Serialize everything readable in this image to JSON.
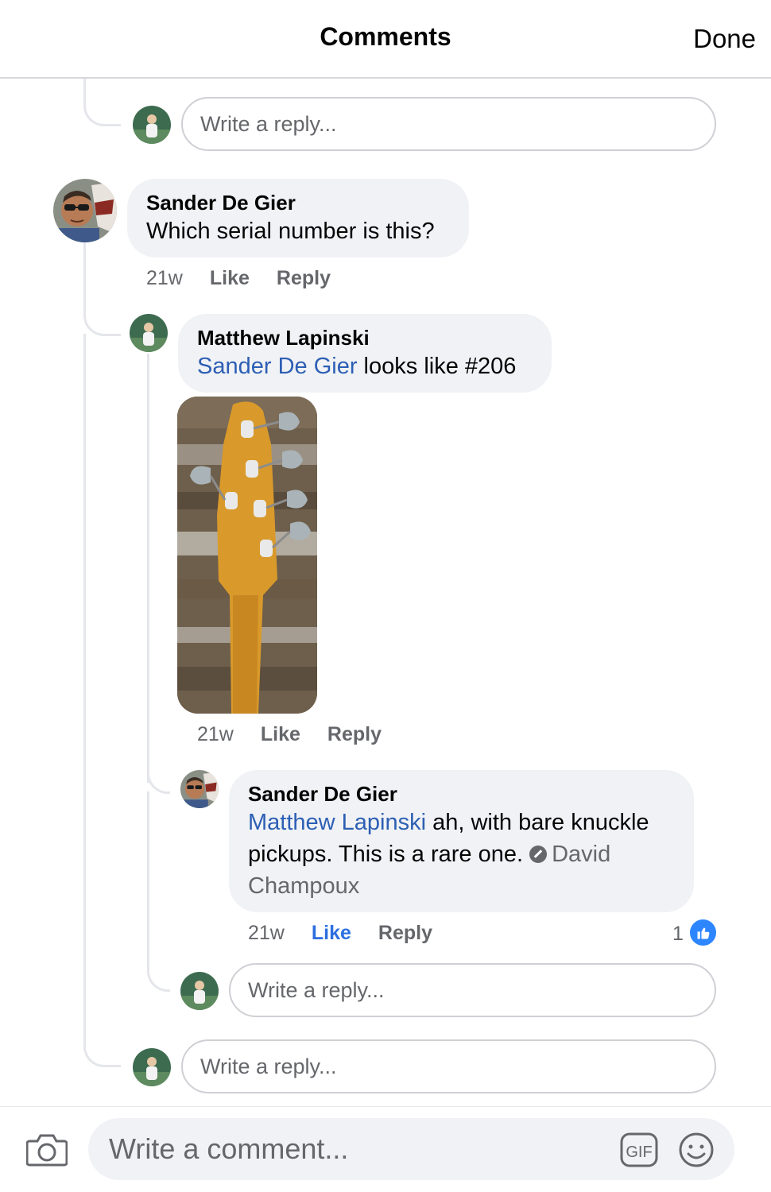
{
  "header": {
    "title": "Comments",
    "done_label": "Done"
  },
  "reply_placeholder": "Write a reply...",
  "comments": [
    {
      "author": "Sander De Gier",
      "text": "Which serial number is this?",
      "time": "21w",
      "like_label": "Like",
      "reply_label": "Reply",
      "replies": [
        {
          "author": "Matthew Lapinski",
          "mention": "Sander De Gier",
          "text": " looks like #206",
          "time": "21w",
          "like_label": "Like",
          "reply_label": "Reply",
          "has_photo": true,
          "replies": [
            {
              "author": "Sander De Gier",
              "mention": "Matthew Lapinski",
              "text": " ah, with bare knuckle pickups. This is a rare one.",
              "mention_removed": "David Champoux",
              "time": "21w",
              "like_label": "Like",
              "liked": true,
              "reply_label": "Reply",
              "reaction_count": "1"
            }
          ]
        }
      ]
    }
  ],
  "composer": {
    "placeholder": "Write a comment...",
    "gif_label": "GIF"
  },
  "colors": {
    "mention": "#2d5fb4",
    "liked": "#2d6fe0",
    "bubble": "#f0f2f5",
    "like_badge": "#2d86ff"
  }
}
